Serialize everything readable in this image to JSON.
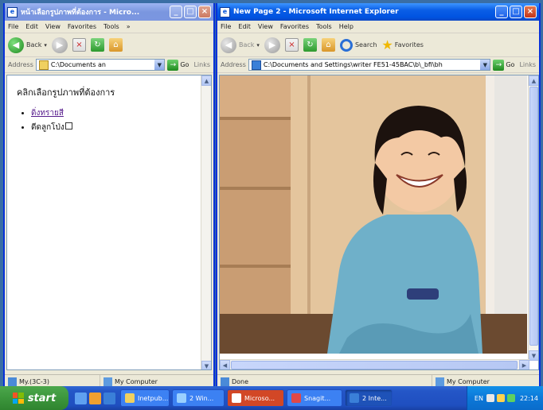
{
  "left_window": {
    "title": "หน้าเลือกรูปภาพที่ต้องการ - Micro...",
    "menu": [
      "File",
      "Edit",
      "View",
      "Favorites",
      "Tools",
      "»"
    ],
    "back_label": "Back",
    "address_label": "Address",
    "address_value": "C:\\Documents an",
    "go_label": "Go",
    "links_label": "Links",
    "heading": "คลิกเลือกรูปภาพที่ต้องการ",
    "list": [
      "ดิ่งทรายสี",
      "ดีดลูกโป่ง"
    ],
    "status_left": "My.(3C-3)",
    "status_right": "My Computer"
  },
  "right_window": {
    "title": "New Page 2 - Microsoft Internet Explorer",
    "menu": [
      "File",
      "Edit",
      "View",
      "Favorites",
      "Tools",
      "Help"
    ],
    "back_label": "Back",
    "search_label": "Search",
    "favorites_label": "Favorites",
    "address_label": "Address",
    "address_value": "C:\\Documents and Settings\\writer FE51-45BAC\\b\\_bfi\\bh",
    "go_label": "Go",
    "links_label": "Links",
    "status_left": "Done",
    "status_right": "My Computer"
  },
  "taskbar": {
    "start_label": "start",
    "tasks": [
      {
        "label": "Inetpub..."
      },
      {
        "label": "2 Win..."
      },
      {
        "label": "Microso..."
      },
      {
        "label": "Snagit..."
      },
      {
        "label": "2 Inte..."
      }
    ],
    "tray_text": "EN",
    "clock": "22:14"
  },
  "colors": {
    "title_active": "#0a5ee6",
    "title_inactive": "#7a96df",
    "taskbar": "#2456c7",
    "start": "#3c963c"
  }
}
